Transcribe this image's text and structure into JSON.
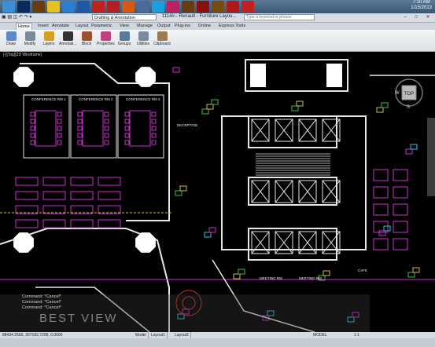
{
  "taskbar": {
    "icons": [
      {
        "name": "start-orb-icon",
        "color": "#3a8fd6"
      },
      {
        "name": "photoshop-icon",
        "color": "#0a2a5a"
      },
      {
        "name": "bridge-icon",
        "color": "#6b3b10"
      },
      {
        "name": "chrome-icon",
        "color": "#e6c21d"
      },
      {
        "name": "ie-icon",
        "color": "#2a7fd0"
      },
      {
        "name": "outlook-icon",
        "color": "#1c5aa8"
      },
      {
        "name": "acrobat-icon",
        "color": "#c0231b"
      },
      {
        "name": "pen-icon",
        "color": "#b02020"
      },
      {
        "name": "fire-icon",
        "color": "#d45a10"
      },
      {
        "name": "people-icon",
        "color": "#4a6a9a"
      },
      {
        "name": "skype-icon",
        "color": "#1aa0e0"
      },
      {
        "name": "ve-icon",
        "color": "#c02060"
      },
      {
        "name": "bridge2-icon",
        "color": "#6b3b10"
      },
      {
        "name": "autocad-icon",
        "color": "#8a1010"
      },
      {
        "name": "br-icon",
        "color": "#7a4a10"
      },
      {
        "name": "acad-icon",
        "color": "#b01818"
      },
      {
        "name": "pdf-icon",
        "color": "#c02020"
      }
    ],
    "time": "7:10 AM",
    "date": "1/15/2013"
  },
  "titlebar": {
    "workspace": "Drafting & Annotation",
    "title": "1114#-- Renault - Furniture Layou...",
    "search_placeholder": "Type a keyword or phrase"
  },
  "tabs": [
    "Home",
    "Insert",
    "Annotate",
    "Layout",
    "Parametric",
    "View",
    "Manage",
    "Output",
    "Plug-ins",
    "Online",
    "Express Tools"
  ],
  "ribbon": [
    {
      "label": "Draw",
      "icon": "draw-icon",
      "color": "#5a8ac8"
    },
    {
      "label": "Modify",
      "icon": "modify-icon",
      "color": "#7a8a9a"
    },
    {
      "label": "Layers",
      "icon": "layers-icon",
      "color": "#d8a020"
    },
    {
      "label": "Annotati...",
      "icon": "annotation-icon",
      "color": "#333"
    },
    {
      "label": "Block",
      "icon": "block-icon",
      "color": "#a05030"
    },
    {
      "label": "Properties",
      "icon": "properties-icon",
      "color": "#c04080"
    },
    {
      "label": "Groups",
      "icon": "groups-icon",
      "color": "#5a7a9a"
    },
    {
      "label": "Utilities",
      "icon": "utilities-icon",
      "color": "#7a8aa0"
    },
    {
      "label": "Clipboard",
      "icon": "clipboard-icon",
      "color": "#9a7a50"
    }
  ],
  "viewport": {
    "label": "[-][Top][2D Wireframe]",
    "viewcube": {
      "top": "TOP",
      "w": "W",
      "s": "S"
    },
    "rooms": [
      "CONFERENCE RM 1",
      "CONFERENCE RM 2",
      "CONFERENCE RM 3",
      "RECEPTION",
      "MEETING RM",
      "MEETING RM",
      "CAFE"
    ]
  },
  "command": {
    "lines": [
      "Command: *Cancel*",
      "Command: *Cancel*",
      "Command: *Cancel*"
    ],
    "watermark": "BEST VIEW"
  },
  "status": {
    "coords": "88434.2560, 307182.7299, 0.0000",
    "layout_tabs": [
      "Model",
      "Layout1",
      "Layout2"
    ],
    "model_label": "MODEL",
    "scale": "1:1"
  }
}
